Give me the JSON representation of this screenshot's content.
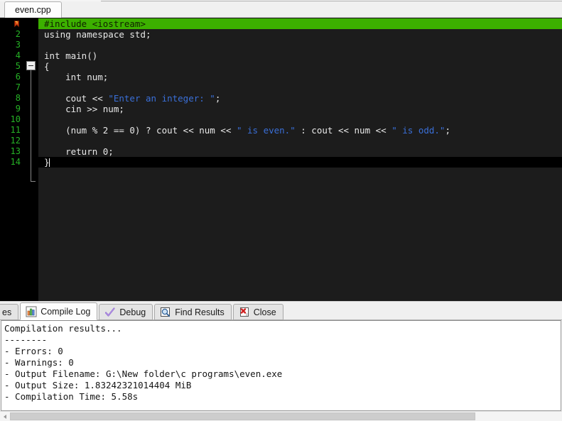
{
  "window": {
    "app": "Dev-C++ IDE",
    "accent_green": "#3cb000",
    "editor_bg": "#1c1c1c",
    "gutter_bg": "#000000",
    "linenum_color": "#26b326",
    "string_color": "#3a6fd8",
    "panel_bg": "#f0f0f0"
  },
  "file_tabs": [
    {
      "label": "even.cpp",
      "active": true
    }
  ],
  "editor": {
    "line_numbers": [
      "1",
      "2",
      "3",
      "4",
      "5",
      "6",
      "7",
      "8",
      "9",
      "10",
      "11",
      "12",
      "13",
      "14"
    ],
    "line1_marker_icon": "bookmark-icon",
    "fold_marker_icon": "fold-collapse-icon",
    "fold_start_line": 5,
    "fold_end_line": 14,
    "current_line": 1,
    "caret_line": 14,
    "lines": [
      {
        "n": "1",
        "text": "#include <iostream>"
      },
      {
        "n": "2",
        "text": "using namespace std;"
      },
      {
        "n": "3",
        "text": ""
      },
      {
        "n": "4",
        "text": "int main()"
      },
      {
        "n": "5",
        "text": "{"
      },
      {
        "n": "6",
        "text": "    int num;"
      },
      {
        "n": "7",
        "text": ""
      },
      {
        "n": "8",
        "text": "    cout << \"Enter an integer: \";"
      },
      {
        "n": "9",
        "text": "    cin >> num;"
      },
      {
        "n": "10",
        "text": ""
      },
      {
        "n": "11",
        "text": "    (num % 2 == 0) ? cout << num << \" is even.\" : cout << num << \" is odd.\";"
      },
      {
        "n": "12",
        "text": ""
      },
      {
        "n": "13",
        "text": "    return 0;"
      },
      {
        "n": "14",
        "text": "}"
      }
    ],
    "segments": {
      "l1_a": "#include <iostream>",
      "l2_a": "using namespace std;",
      "l4_a": "int main()",
      "l5_a": "{",
      "l6_a": "    int num;",
      "l8_a": "    cout << ",
      "l8_str": "\"Enter an integer: \"",
      "l8_b": ";",
      "l9_a": "    cin >> num;",
      "l11_a": "    (num % 2 == 0) ? cout << num << ",
      "l11_str1": "\" is even.\"",
      "l11_b": " : cout << num << ",
      "l11_str2": "\" is odd.\"",
      "l11_c": ";",
      "l13_a": "    return 0;",
      "l14_a": "}"
    }
  },
  "panel": {
    "tabs": [
      {
        "label": "es",
        "icon": "resources-icon",
        "active": false,
        "clipped": true
      },
      {
        "label": "Compile Log",
        "icon": "bar-chart-icon",
        "active": true,
        "clipped": false
      },
      {
        "label": "Debug",
        "icon": "check-icon",
        "active": false,
        "clipped": false
      },
      {
        "label": "Find Results",
        "icon": "magnifier-document-icon",
        "active": false,
        "clipped": false
      },
      {
        "label": "Close",
        "icon": "red-x-document-icon",
        "active": false,
        "clipped": false
      }
    ],
    "log": {
      "lines": [
        "Compilation results...",
        "--------",
        "- Errors: 0",
        "- Warnings: 0",
        "- Output Filename: G:\\New folder\\c programs\\even.exe",
        "- Output Size: 1.83242321014404 MiB",
        "- Compilation Time: 5.58s"
      ],
      "l0": "Compilation results...",
      "l1": "--------",
      "l2": "- Errors: 0",
      "l3": "- Warnings: 0",
      "l4": "- Output Filename: G:\\New folder\\c programs\\even.exe",
      "l5": "- Output Size: 1.83242321014404 MiB",
      "l6": "- Compilation Time: 5.58s"
    }
  },
  "scrollbar": {
    "left_arrow_icon": "arrow-left-icon",
    "thumb_label": "horizontal-scroll-thumb"
  }
}
